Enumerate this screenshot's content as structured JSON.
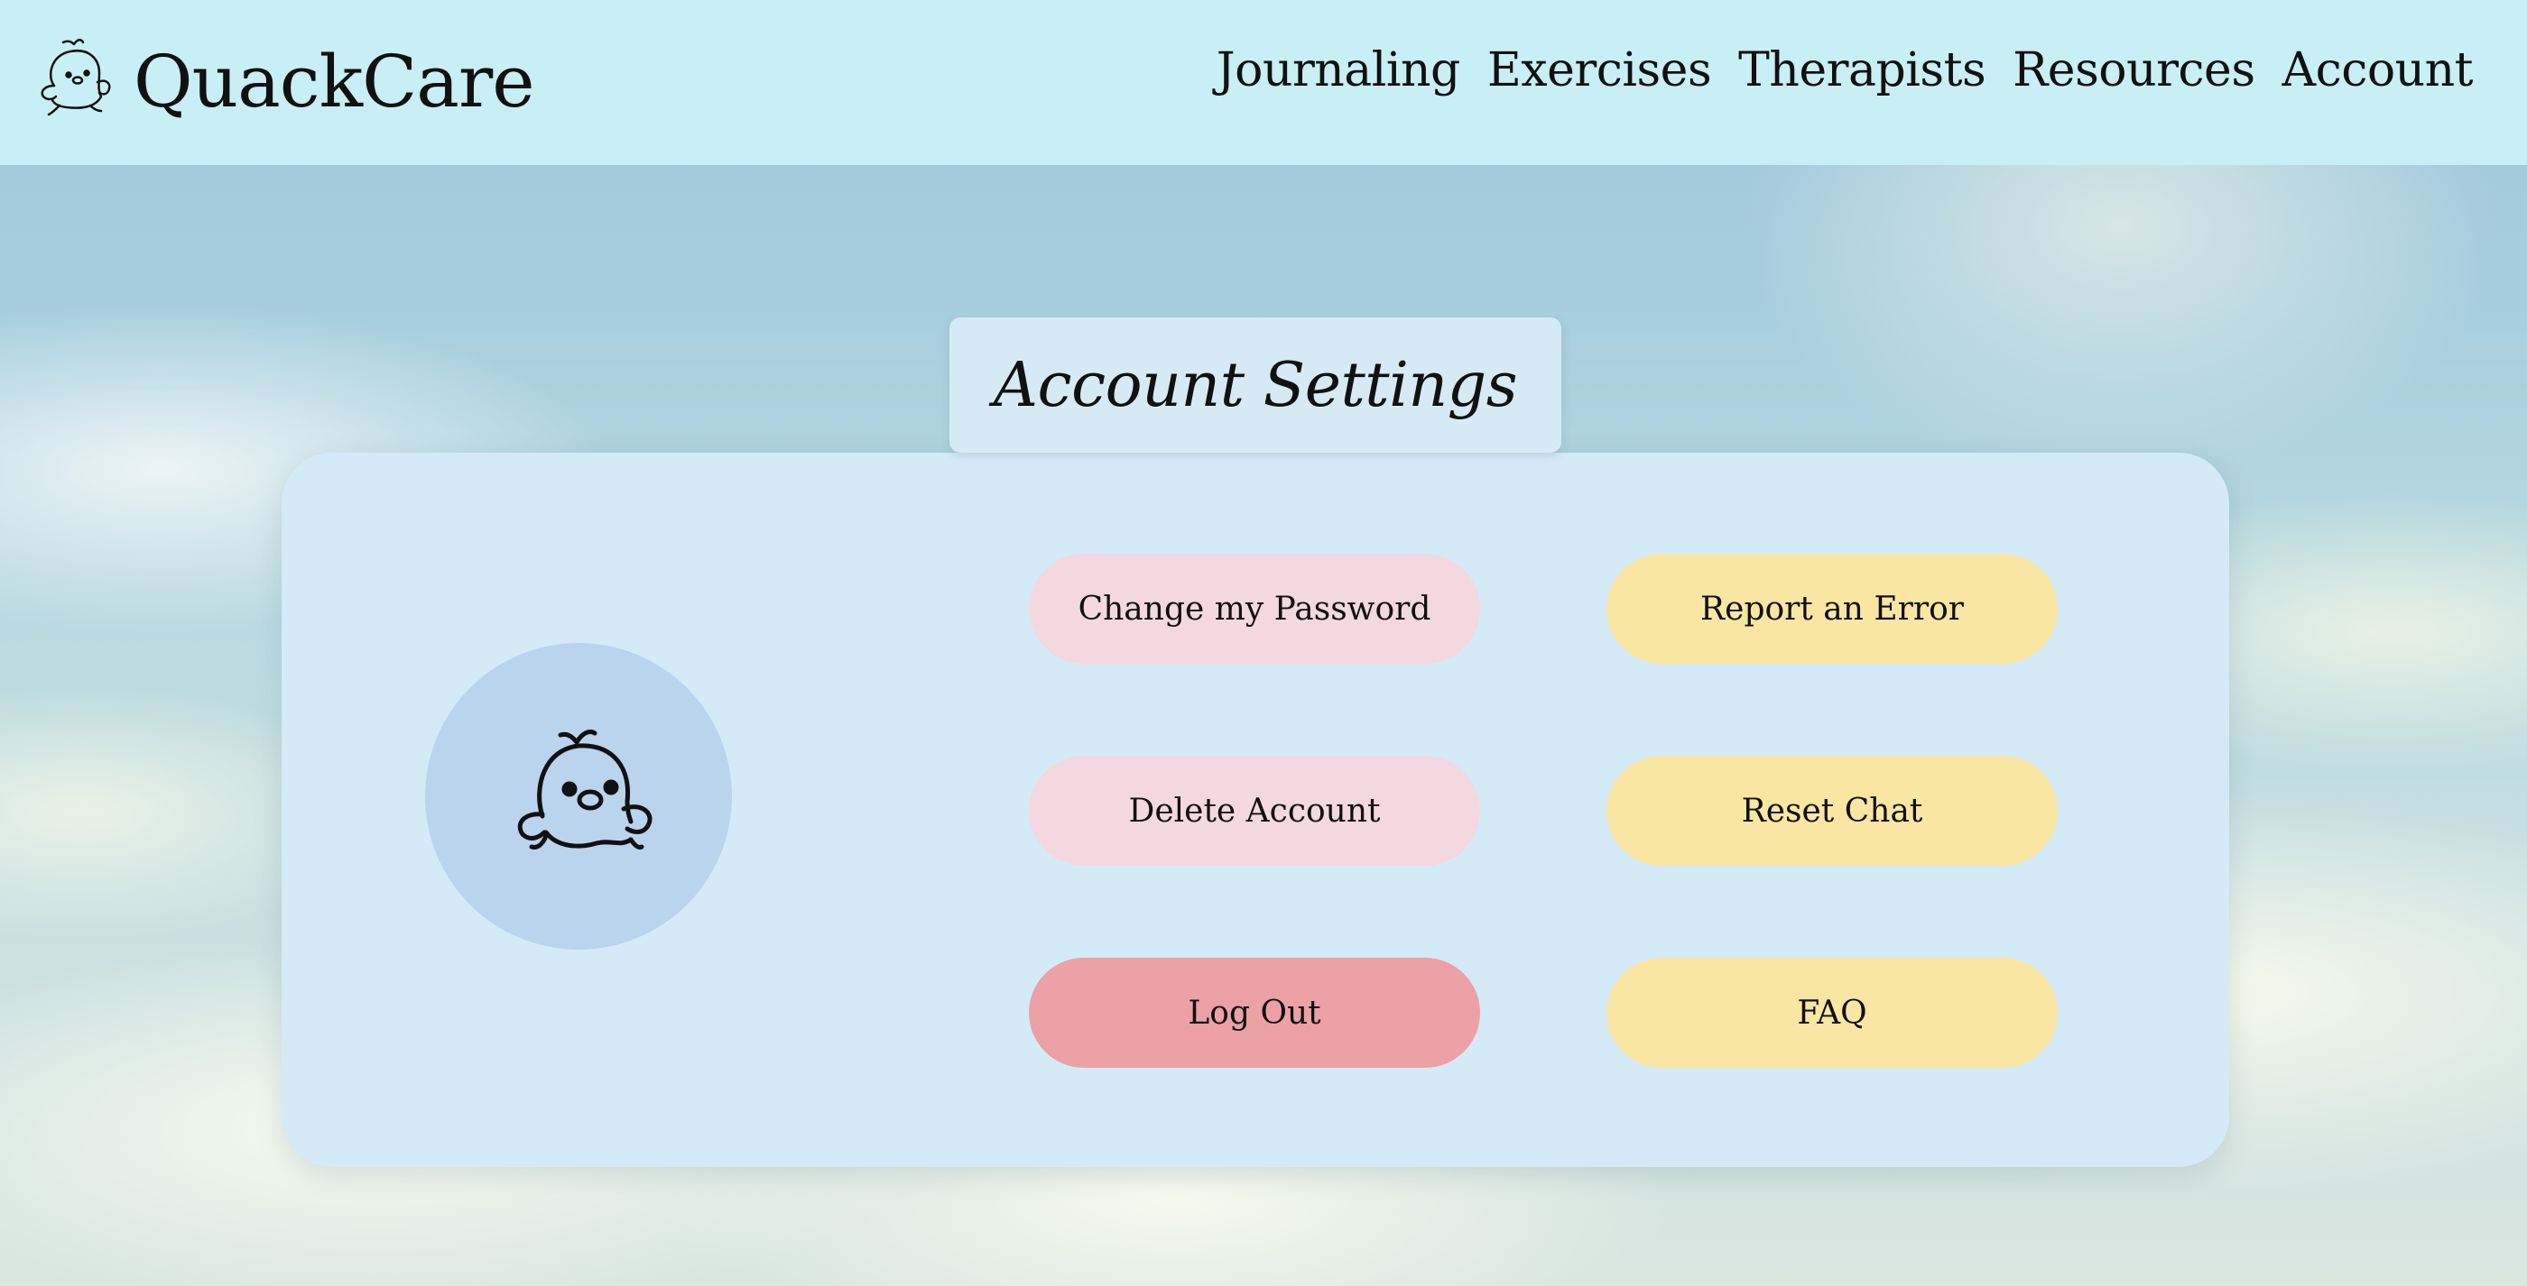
{
  "app": {
    "name": "QuackCare",
    "logo_icon": "duck-icon"
  },
  "nav": {
    "items": [
      {
        "label": "Journaling"
      },
      {
        "label": "Exercises"
      },
      {
        "label": "Therapists"
      },
      {
        "label": "Resources"
      },
      {
        "label": "Account"
      }
    ]
  },
  "page": {
    "title": "Account Settings"
  },
  "profile": {
    "avatar_icon": "duck-icon"
  },
  "actions": {
    "change_password": "Change my Password",
    "report_error": "Report an Error",
    "delete_account": "Delete Account",
    "reset_chat": "Reset Chat",
    "log_out": "Log Out",
    "faq": "FAQ"
  },
  "colors": {
    "header_bg": "#c8eef6",
    "panel_bg": "#d5eaf7",
    "avatar_bg": "#bad4ee",
    "pink_button": "#f3d8e0",
    "yellow_button": "#f9e6a3",
    "red_button": "#eba1a5"
  }
}
